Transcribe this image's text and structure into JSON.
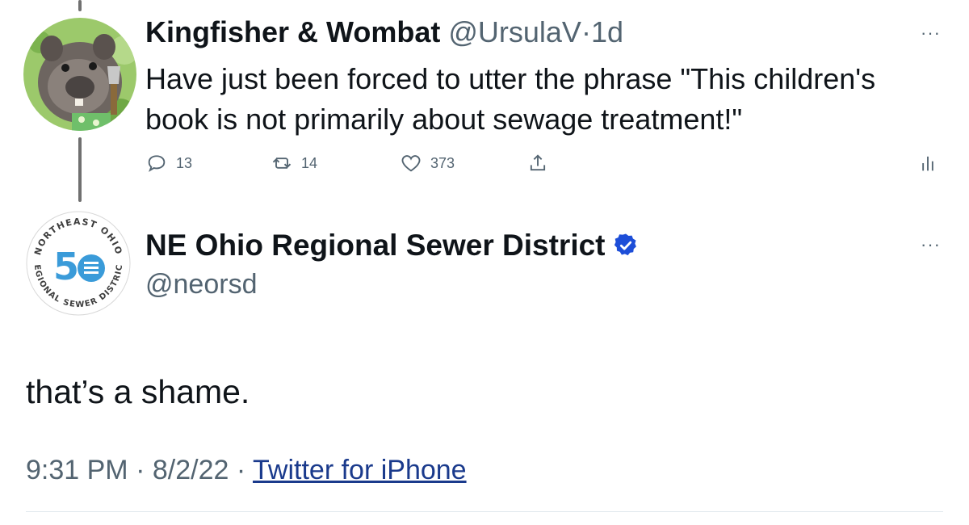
{
  "parent_tweet": {
    "author_name": "Kingfisher & Wombat",
    "handle": "@UrsulaV",
    "separator": "·",
    "age": "1d",
    "text": "Have just been forced to utter the phrase \"This children's book is not primarily about sewage treatment!\"",
    "more_label": "···",
    "actions": {
      "replies": "13",
      "retweets": "14",
      "likes": "373"
    },
    "avatar_icon": "wombat-avatar"
  },
  "reply_tweet": {
    "author_name": "NE Ohio Regional Sewer District",
    "handle": "@neorsd",
    "verified_icon": "verified-badge-icon",
    "more_label": "···",
    "text": "that’s a shame.",
    "time": "9:31 PM",
    "separator": "·",
    "date": "8/2/22",
    "source": "Twitter for iPhone",
    "logo": {
      "top_text": "NORTHEAST OHIO",
      "bottom_text": "REGIONAL SEWER DISTRICT",
      "number": "50"
    }
  },
  "colors": {
    "accent": "#1d9bf0",
    "logo_blue": "#3a9bd9",
    "verified": "#1d4ed8",
    "muted": "#536471",
    "link": "#1a3a8c"
  }
}
